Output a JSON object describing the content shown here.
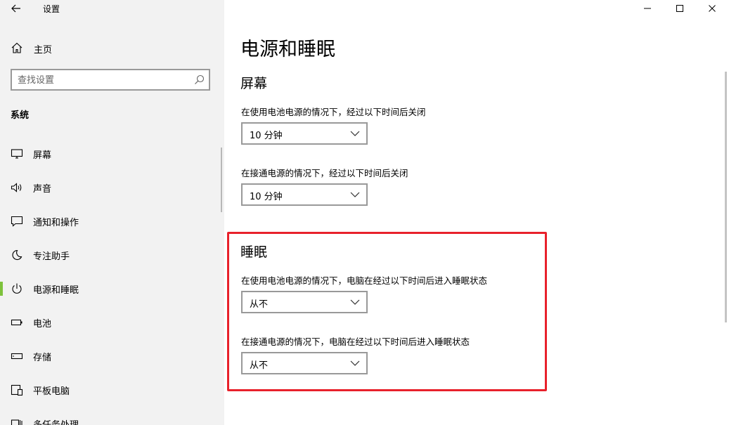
{
  "window": {
    "title": "设置",
    "controls": [
      "minimize",
      "maximize",
      "close"
    ]
  },
  "sidebar": {
    "home_label": "主页",
    "search_placeholder": "查找设置",
    "section": "系统",
    "items": [
      {
        "label": "屏幕",
        "icon": "monitor-icon",
        "active": false
      },
      {
        "label": "声音",
        "icon": "speaker-icon",
        "active": false
      },
      {
        "label": "通知和操作",
        "icon": "notification-icon",
        "active": false
      },
      {
        "label": "专注助手",
        "icon": "moon-icon",
        "active": false
      },
      {
        "label": "电源和睡眠",
        "icon": "power-icon",
        "active": true
      },
      {
        "label": "电池",
        "icon": "battery-icon",
        "active": false
      },
      {
        "label": "存储",
        "icon": "storage-icon",
        "active": false
      },
      {
        "label": "平板电脑",
        "icon": "tablet-icon",
        "active": false
      },
      {
        "label": "多任务处理",
        "icon": "multitask-icon",
        "active": false
      }
    ]
  },
  "main": {
    "title": "电源和睡眠",
    "screen": {
      "heading": "屏幕",
      "battery_label": "在使用电池电源的情况下，经过以下时间后关闭",
      "battery_value": "10 分钟",
      "plugged_label": "在接通电源的情况下，经过以下时间后关闭",
      "plugged_value": "10 分钟"
    },
    "sleep": {
      "heading": "睡眠",
      "battery_label": "在使用电池电源的情况下，电脑在经过以下时间后进入睡眠状态",
      "battery_value": "从不",
      "plugged_label": "在接通电源的情况下，电脑在经过以下时间后进入睡眠状态",
      "plugged_value": "从不"
    }
  },
  "colors": {
    "active_indicator": "#7ec23c",
    "highlight_border": "#e8212b",
    "sidebar_bg": "#f2f2f2"
  }
}
